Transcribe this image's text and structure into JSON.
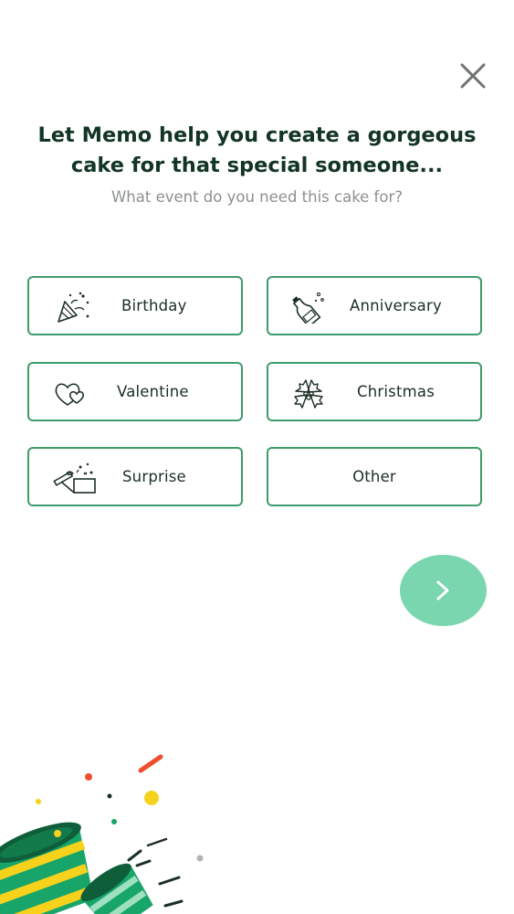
{
  "header": {
    "title": "Let Memo help you create a gorgeous cake for that special someone...",
    "subtitle": "What event do you need this cake for?"
  },
  "options": [
    {
      "label": "Birthday",
      "icon": "party-popper-icon"
    },
    {
      "label": "Anniversary",
      "icon": "champagne-bottle-icon"
    },
    {
      "label": "Valentine",
      "icon": "hearts-icon"
    },
    {
      "label": "Christmas",
      "icon": "holly-icon"
    },
    {
      "label": "Surprise",
      "icon": "surprise-box-icon"
    },
    {
      "label": "Other",
      "icon": ""
    }
  ],
  "colors": {
    "accent": "#3f9c6c",
    "title": "#123524",
    "next_button": "#79d6ae",
    "confetti_green": "#17a56a",
    "confetti_yellow": "#f7d21c",
    "confetti_red": "#ef4e2c"
  },
  "icons": {
    "close": "close-icon",
    "next": "chevron-right-icon"
  }
}
